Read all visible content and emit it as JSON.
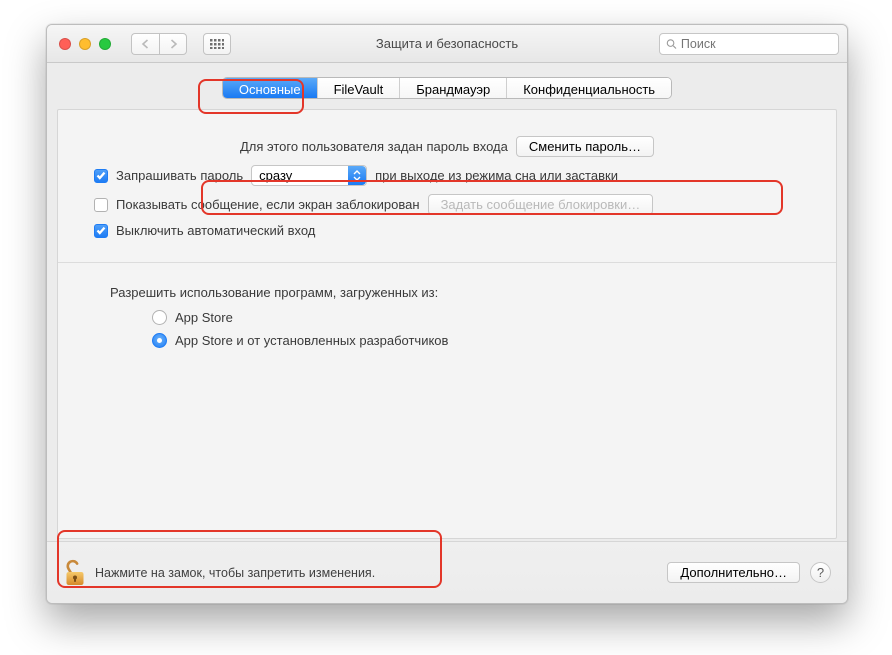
{
  "window": {
    "title": "Защита и безопасность"
  },
  "search": {
    "placeholder": "Поиск"
  },
  "tabs": {
    "general": "Основные",
    "filevault": "FileVault",
    "firewall": "Брандмауэр",
    "privacy": "Конфиденциальность"
  },
  "general": {
    "login_password_set_label": "Для этого пользователя задан пароль входа",
    "change_password_button": "Сменить пароль…",
    "require_password_checkbox": true,
    "require_password_label_before": "Запрашивать пароль",
    "require_password_delay_selected": "сразу",
    "require_password_label_after": "при выходе из режима сна или заставки",
    "show_lock_message_checkbox": false,
    "show_lock_message_label": "Показывать сообщение, если экран заблокирован",
    "set_lock_message_button": "Задать сообщение блокировки…",
    "disable_autologin_checkbox": true,
    "disable_autologin_label": "Выключить автоматический вход",
    "allow_apps_label": "Разрешить использование программ, загруженных из:",
    "allow_apps_options": {
      "app_store": "App Store",
      "app_store_and_identified": "App Store и от установленных разработчиков"
    },
    "allow_apps_selected": "app_store_and_identified"
  },
  "footer": {
    "lock_message": "Нажмите на замок, чтобы запретить изменения.",
    "advanced_button": "Дополнительно…",
    "help_label": "?"
  }
}
